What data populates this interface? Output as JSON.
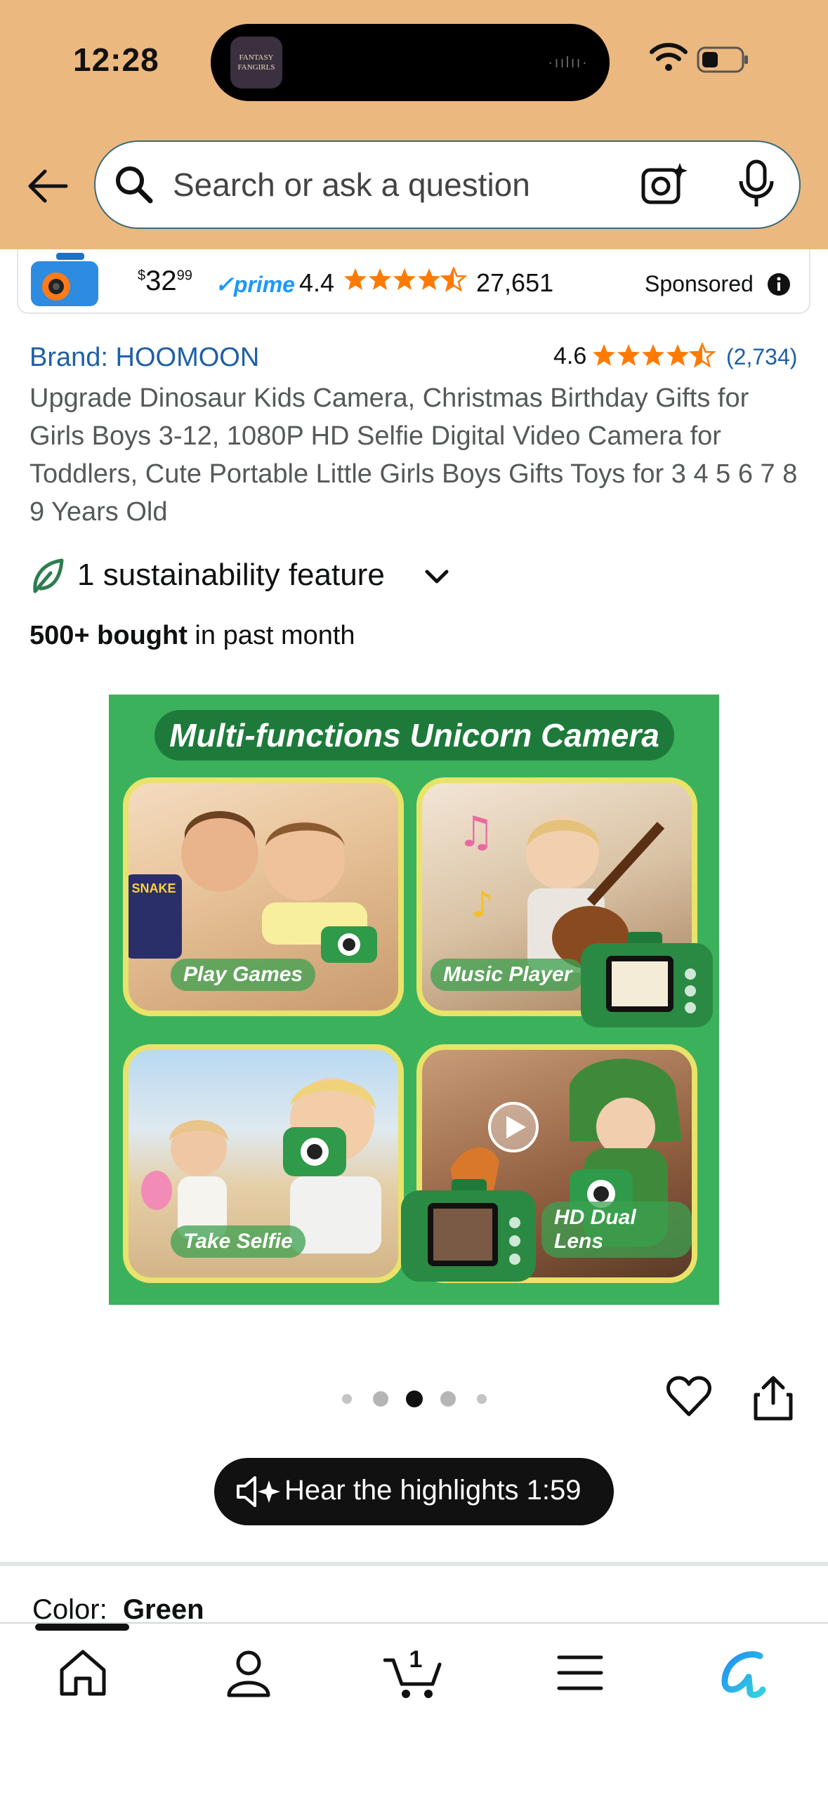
{
  "status_bar": {
    "time": "12:28",
    "island_logo_text": "FANTASY FANGIRLS"
  },
  "header": {
    "search_placeholder": "Search or ask a question"
  },
  "sponsored_ad": {
    "price_symbol": "$",
    "price_whole": "32",
    "price_fraction": "99",
    "prime_label": "prime",
    "rating": "4.4",
    "rating_count": "27,651",
    "label": "Sponsored"
  },
  "product": {
    "brand": "Brand: HOOMOON",
    "rating": "4.6",
    "rating_count": "(2,734)",
    "title": "Upgrade Dinosaur Kids Camera, Christmas Birthday Gifts for Girls Boys 3-12, 1080P HD Selfie Digital Video Camera for Toddlers, Cute Portable Little Girls Boys Gifts Toys for 3 4 5 6 7 8 9 Years Old",
    "sustainability": "1 sustainability feature",
    "bought_bold": "500+ bought",
    "bought_rest": " in past month"
  },
  "hero_image": {
    "banner": "Multi-functions Unicorn Camera",
    "tiles": [
      "Play Games",
      "Music Player",
      "Take Selfie",
      "HD Dual Lens"
    ],
    "snake_text": "SNAKE"
  },
  "carousel": {
    "active_index": 2,
    "count": 5
  },
  "audio_summary": {
    "label": "Hear the highlights 1:59"
  },
  "variation": {
    "color_label": "Color:",
    "color_value": "Green"
  },
  "bottom_nav": {
    "cart_count": "1",
    "items": [
      "home-icon",
      "account-icon",
      "cart-icon",
      "menu-icon",
      "rufus-icon"
    ]
  },
  "colors": {
    "header_bg": "#ebb87f",
    "link": "#1f5fa6",
    "star": "#ff7a00",
    "hero_green": "#3cb15c"
  }
}
